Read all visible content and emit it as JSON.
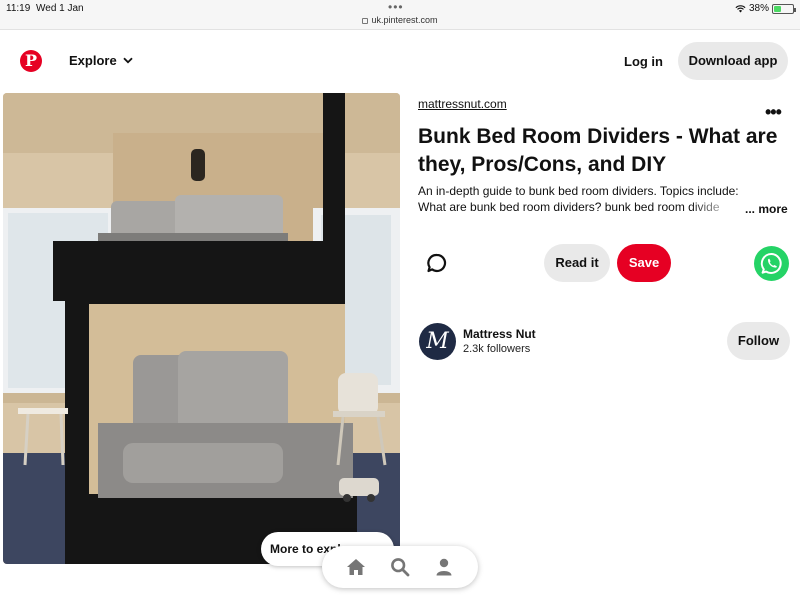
{
  "status_bar": {
    "time": "11:19",
    "date": "Wed 1 Jan",
    "dots": "•••",
    "url": "uk.pinterest.com",
    "battery_percent": "38%",
    "battery_level": 0.38
  },
  "header": {
    "logo": "P",
    "explore_label": "Explore",
    "login_label": "Log in",
    "download_label": "Download app"
  },
  "pin": {
    "domain": "mattressnut.com",
    "title": "Bunk Bed Room Dividers - What are they, Pros/Cons, and DIY",
    "description_line1": "An in-depth guide to bunk bed room dividers. Topics include:",
    "description_line2": "What are bunk bed room dividers? bunk bed room divide",
    "more_label": "... more",
    "options_label": "•••",
    "read_label": "Read it",
    "save_label": "Save",
    "more_to_explore_label": "More to explore"
  },
  "author": {
    "initial": "M",
    "name": "Mattress Nut",
    "followers": "2.3k followers",
    "follow_label": "Follow"
  },
  "icons": {
    "logo": "pinterest-logo",
    "explore_chevron": "chevron-down-icon",
    "comment": "comment-icon",
    "share": "whatsapp-icon",
    "nav": [
      "home-icon",
      "search-icon",
      "profile-icon"
    ]
  },
  "colors": {
    "brand_red": "#e60023",
    "whatsapp_green": "#25d366",
    "button_gray": "#e9e9e9"
  }
}
